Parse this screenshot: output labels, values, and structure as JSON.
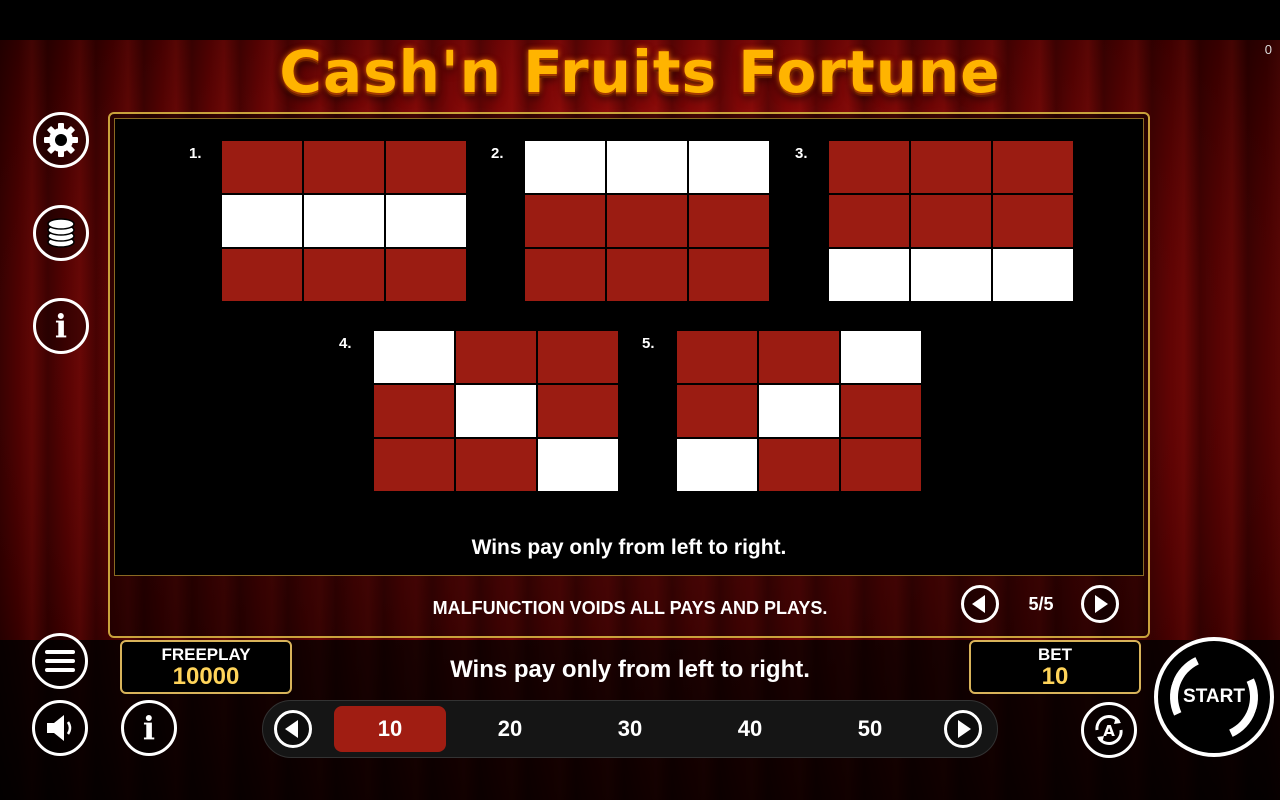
{
  "game": {
    "title": "Cash'n Fruits Fortune",
    "corner_counter": "0"
  },
  "paylines": [
    {
      "label": "1.",
      "cells": [
        0,
        0,
        0,
        1,
        1,
        1,
        0,
        0,
        0
      ]
    },
    {
      "label": "2.",
      "cells": [
        1,
        1,
        1,
        0,
        0,
        0,
        0,
        0,
        0
      ]
    },
    {
      "label": "3.",
      "cells": [
        0,
        0,
        0,
        0,
        0,
        0,
        1,
        1,
        1
      ]
    },
    {
      "label": "4.",
      "cells": [
        1,
        0,
        0,
        0,
        1,
        0,
        0,
        0,
        1
      ]
    },
    {
      "label": "5.",
      "cells": [
        0,
        0,
        1,
        0,
        1,
        0,
        1,
        0,
        0
      ]
    }
  ],
  "paytable": {
    "wins_note": "Wins pay only from left to right.",
    "malfunction": "MALFUNCTION VOIDS ALL PAYS AND PLAYS.",
    "page": "5/5"
  },
  "balance": {
    "label": "FREEPLAY",
    "value": "10000"
  },
  "message": "Wins pay only from left to right.",
  "bet": {
    "label": "BET",
    "value": "10"
  },
  "lines": {
    "options": [
      "10",
      "20",
      "30",
      "40",
      "50"
    ],
    "selected_index": 0
  },
  "start": {
    "label": "START"
  },
  "colors": {
    "cell_off": "#9b1c12",
    "cell_on": "#ffffff",
    "accent_gold": "#d8b35a",
    "value_gold": "#ffd45a",
    "selected_line": "#a01d12"
  }
}
